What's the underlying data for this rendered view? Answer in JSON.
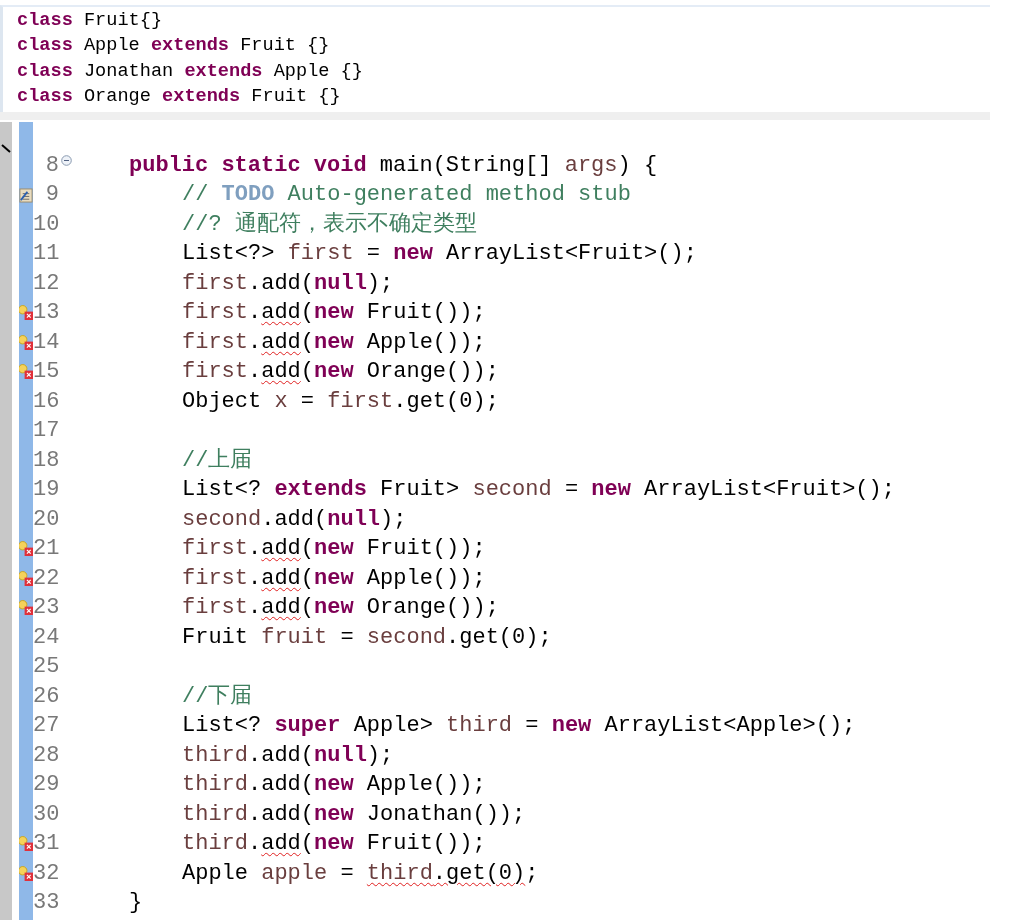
{
  "snippet": {
    "lines": [
      {
        "tokens": [
          {
            "text": "class",
            "kind": "kw"
          },
          {
            "text": " Fruit{}",
            "kind": "plain"
          }
        ]
      },
      {
        "tokens": [
          {
            "text": "class",
            "kind": "kw"
          },
          {
            "text": " Apple ",
            "kind": "plain"
          },
          {
            "text": "extends",
            "kind": "kw"
          },
          {
            "text": " Fruit {}",
            "kind": "plain"
          }
        ]
      },
      {
        "tokens": [
          {
            "text": "class",
            "kind": "kw"
          },
          {
            "text": " Jonathan ",
            "kind": "plain"
          },
          {
            "text": "extends",
            "kind": "kw"
          },
          {
            "text": " Apple {}",
            "kind": "plain"
          }
        ]
      },
      {
        "tokens": [
          {
            "text": "class",
            "kind": "kw"
          },
          {
            "text": " Orange ",
            "kind": "plain"
          },
          {
            "text": "extends",
            "kind": "kw"
          },
          {
            "text": " Fruit {}",
            "kind": "plain"
          }
        ]
      }
    ]
  },
  "editor": {
    "lines": [
      {
        "number": "8",
        "kind": "fold",
        "tokens": [
          {
            "text": "public static void",
            "kind": "kw"
          },
          {
            "text": " main(String[] ",
            "kind": "plain"
          },
          {
            "text": "args",
            "kind": "var"
          },
          {
            "text": ") {",
            "kind": "plain"
          }
        ],
        "children": [
          {
            "number": "9",
            "kind": "task",
            "tokens": [
              {
                "text": "// ",
                "kind": "comment"
              },
              {
                "text": "TODO",
                "kind": "todo"
              },
              {
                "text": " Auto-generated method stub",
                "kind": "comment"
              }
            ]
          },
          {
            "number": "10",
            "tokens": [
              {
                "text": "//? 通配符，表示不确定类型",
                "kind": "comment"
              }
            ]
          },
          {
            "number": "11",
            "tokens": [
              {
                "text": "List<?> ",
                "kind": "plain"
              },
              {
                "text": "first",
                "kind": "var"
              },
              {
                "text": " = ",
                "kind": "plain"
              },
              {
                "text": "new",
                "kind": "kw"
              },
              {
                "text": " ArrayList<Fruit>();",
                "kind": "plain"
              }
            ]
          },
          {
            "number": "12",
            "tokens": [
              {
                "text": "first",
                "kind": "var"
              },
              {
                "text": ".add(",
                "kind": "plain"
              },
              {
                "text": "null",
                "kind": "kw"
              },
              {
                "text": ");",
                "kind": "plain"
              }
            ]
          },
          {
            "number": "13",
            "kind": "error",
            "tokens": [
              {
                "text": "first",
                "kind": "var"
              },
              {
                "text": ".",
                "kind": "plain"
              },
              {
                "text": "add",
                "kind": "method-error"
              },
              {
                "text": "(",
                "kind": "plain"
              },
              {
                "text": "new",
                "kind": "kw"
              },
              {
                "text": " Fruit());",
                "kind": "plain"
              }
            ]
          },
          {
            "number": "14",
            "kind": "error",
            "tokens": [
              {
                "text": "first",
                "kind": "var"
              },
              {
                "text": ".",
                "kind": "plain"
              },
              {
                "text": "add",
                "kind": "method-error"
              },
              {
                "text": "(",
                "kind": "plain"
              },
              {
                "text": "new",
                "kind": "kw"
              },
              {
                "text": " Apple());",
                "kind": "plain"
              }
            ]
          },
          {
            "number": "15",
            "kind": "error",
            "tokens": [
              {
                "text": "first",
                "kind": "var"
              },
              {
                "text": ".",
                "kind": "plain"
              },
              {
                "text": "add",
                "kind": "method-error"
              },
              {
                "text": "(",
                "kind": "plain"
              },
              {
                "text": "new",
                "kind": "kw"
              },
              {
                "text": " Orange());",
                "kind": "plain"
              }
            ]
          },
          {
            "number": "16",
            "tokens": [
              {
                "text": "Object ",
                "kind": "plain"
              },
              {
                "text": "x",
                "kind": "var"
              },
              {
                "text": " = ",
                "kind": "plain"
              },
              {
                "text": "first",
                "kind": "var"
              },
              {
                "text": ".get(0);",
                "kind": "plain"
              }
            ]
          },
          {
            "number": "17"
          },
          {
            "number": "18",
            "tokens": [
              {
                "text": "//上届",
                "kind": "comment"
              }
            ]
          },
          {
            "number": "19",
            "tokens": [
              {
                "text": "List<? ",
                "kind": "plain"
              },
              {
                "text": "extends",
                "kind": "kw"
              },
              {
                "text": " Fruit> ",
                "kind": "plain"
              },
              {
                "text": "second",
                "kind": "var"
              },
              {
                "text": " = ",
                "kind": "plain"
              },
              {
                "text": "new",
                "kind": "kw"
              },
              {
                "text": " ArrayList<Fruit>();",
                "kind": "plain"
              }
            ]
          },
          {
            "number": "20",
            "tokens": [
              {
                "text": "second",
                "kind": "var"
              },
              {
                "text": ".add(",
                "kind": "plain"
              },
              {
                "text": "null",
                "kind": "kw"
              },
              {
                "text": ");",
                "kind": "plain"
              }
            ]
          },
          {
            "number": "21",
            "kind": "error",
            "tokens": [
              {
                "text": "first",
                "kind": "var"
              },
              {
                "text": ".",
                "kind": "plain"
              },
              {
                "text": "add",
                "kind": "method-error"
              },
              {
                "text": "(",
                "kind": "plain"
              },
              {
                "text": "new",
                "kind": "kw"
              },
              {
                "text": " Fruit());",
                "kind": "plain"
              }
            ]
          },
          {
            "number": "22",
            "kind": "error",
            "tokens": [
              {
                "text": "first",
                "kind": "var"
              },
              {
                "text": ".",
                "kind": "plain"
              },
              {
                "text": "add",
                "kind": "method-error"
              },
              {
                "text": "(",
                "kind": "plain"
              },
              {
                "text": "new",
                "kind": "kw"
              },
              {
                "text": " Apple());",
                "kind": "plain"
              }
            ]
          },
          {
            "number": "23",
            "kind": "error",
            "tokens": [
              {
                "text": "first",
                "kind": "var"
              },
              {
                "text": ".",
                "kind": "plain"
              },
              {
                "text": "add",
                "kind": "method-error"
              },
              {
                "text": "(",
                "kind": "plain"
              },
              {
                "text": "new",
                "kind": "kw"
              },
              {
                "text": " Orange());",
                "kind": "plain"
              }
            ]
          },
          {
            "number": "24",
            "tokens": [
              {
                "text": "Fruit ",
                "kind": "plain"
              },
              {
                "text": "fruit",
                "kind": "var"
              },
              {
                "text": " = ",
                "kind": "plain"
              },
              {
                "text": "second",
                "kind": "var"
              },
              {
                "text": ".get(0);",
                "kind": "plain"
              }
            ]
          },
          {
            "number": "25"
          },
          {
            "number": "26",
            "tokens": [
              {
                "text": "//下届",
                "kind": "comment"
              }
            ]
          },
          {
            "number": "27",
            "tokens": [
              {
                "text": "List<? ",
                "kind": "plain"
              },
              {
                "text": "super",
                "kind": "kw"
              },
              {
                "text": " Apple> ",
                "kind": "plain"
              },
              {
                "text": "third",
                "kind": "var"
              },
              {
                "text": " = ",
                "kind": "plain"
              },
              {
                "text": "new",
                "kind": "kw"
              },
              {
                "text": " ArrayList<Apple>();",
                "kind": "plain"
              }
            ]
          },
          {
            "number": "28",
            "tokens": [
              {
                "text": "third",
                "kind": "var"
              },
              {
                "text": ".add(",
                "kind": "plain"
              },
              {
                "text": "null",
                "kind": "kw"
              },
              {
                "text": ");",
                "kind": "plain"
              }
            ]
          },
          {
            "number": "29",
            "tokens": [
              {
                "text": "third",
                "kind": "var"
              },
              {
                "text": ".add(",
                "kind": "plain"
              },
              {
                "text": "new",
                "kind": "kw"
              },
              {
                "text": " Apple());",
                "kind": "plain"
              }
            ]
          },
          {
            "number": "30",
            "tokens": [
              {
                "text": "third",
                "kind": "var"
              },
              {
                "text": ".add(",
                "kind": "plain"
              },
              {
                "text": "new",
                "kind": "kw"
              },
              {
                "text": " Jonathan());",
                "kind": "plain"
              }
            ]
          },
          {
            "number": "31",
            "kind": "error",
            "tokens": [
              {
                "text": "third",
                "kind": "var"
              },
              {
                "text": ".",
                "kind": "plain"
              },
              {
                "text": "add",
                "kind": "method-error"
              },
              {
                "text": "(",
                "kind": "plain"
              },
              {
                "text": "new",
                "kind": "kw"
              },
              {
                "text": " Fruit());",
                "kind": "plain"
              }
            ]
          },
          {
            "number": "32",
            "kind": "error",
            "tokens": [
              {
                "text": "Apple ",
                "kind": "plain"
              },
              {
                "text": "apple",
                "kind": "var"
              },
              {
                "text": " = ",
                "kind": "plain"
              },
              {
                "text": "third",
                "kind": "var-error"
              },
              {
                "text": ".get(0)",
                "kind": "method-error"
              },
              {
                "text": ";",
                "kind": "plain"
              }
            ]
          }
        ]
      },
      {
        "number": "33",
        "tokens": [
          {
            "text": "}",
            "kind": "plain"
          }
        ]
      }
    ]
  }
}
